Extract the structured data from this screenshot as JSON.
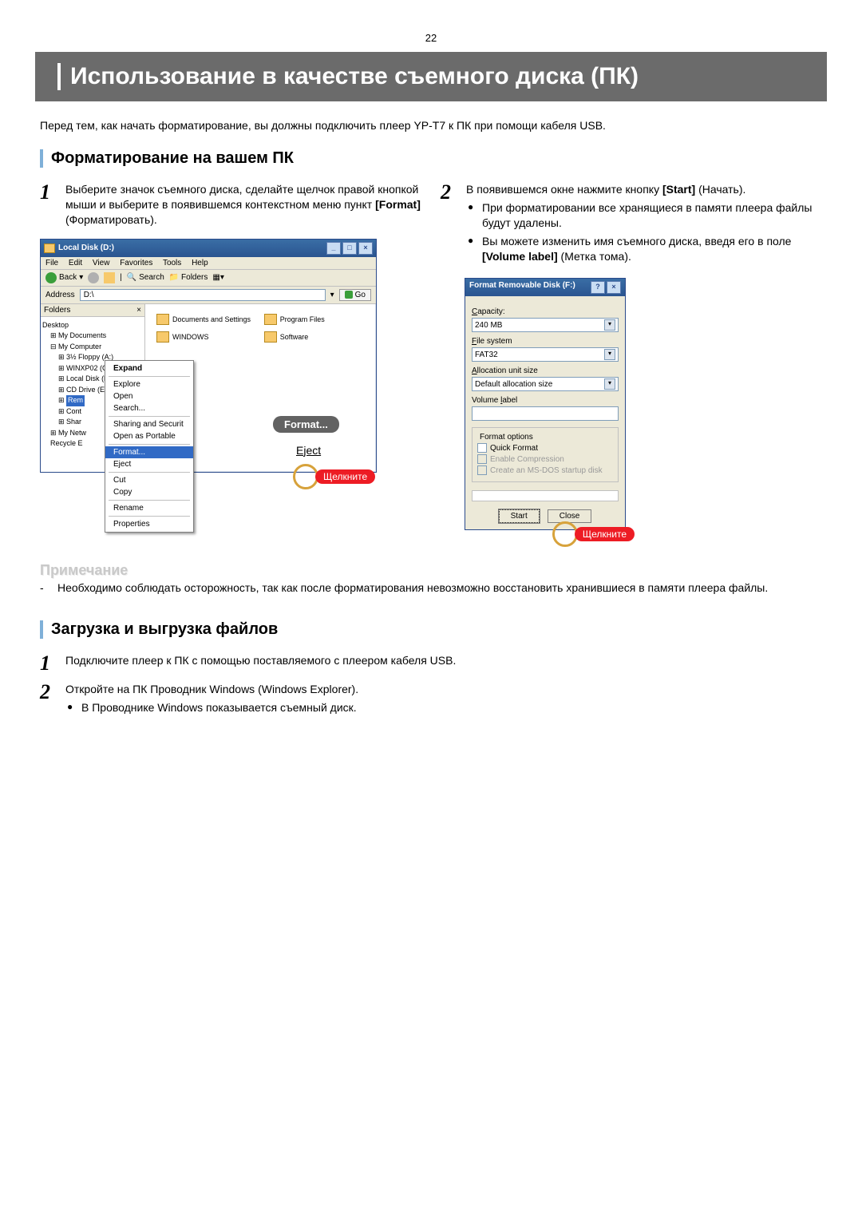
{
  "page_number": "22",
  "title": "Использование в качестве съемного диска (ПК)",
  "intro": "Перед тем, как начать форматирование, вы должны подключить плеер YP-T7 к ПК при помощи кабеля USB.",
  "section1_heading": "Форматирование на вашем ПК",
  "step1_num": "1",
  "step1_text_a": "Выберите значок съемного диска, сделайте щелчок правой кнопкой мыши и выберите в появившемся контекстном меню пункт ",
  "step1_bold": "[Format]",
  "step1_text_b": " (Форматировать).",
  "step2_num": "2",
  "step2_text_a": "В появившемся окне нажмите кнопку ",
  "step2_bold": "[Start]",
  "step2_text_b": " (Начать).",
  "step2_bullet1": "При форматировании все хранящиеся в памяти плеера файлы будут удалены.",
  "step2_bullet2_a": "Вы можете изменить имя съемного диска, введя его в поле ",
  "step2_bullet2_bold": "[Volume label]",
  "step2_bullet2_b": " (Метка тома).",
  "explorer": {
    "title": "Local Disk (D:)",
    "menu": [
      "File",
      "Edit",
      "View",
      "Favorites",
      "Tools",
      "Help"
    ],
    "toolbar_back": "Back",
    "toolbar_search": "Search",
    "toolbar_folders": "Folders",
    "address_label": "Address",
    "address_value": "D:\\",
    "go": "Go",
    "folders_header": "Folders",
    "tree": {
      "desktop": "Desktop",
      "mydocs": "My Documents",
      "mycomputer": "My Computer",
      "floppy": "3½ Floppy (A:)",
      "winxp": "WINXP02 (C:)",
      "localdisk": "Local Disk (D:)",
      "cddrive": "CD Drive (E:)",
      "removable": "Rem",
      "control": "Cont",
      "shared": "Shar",
      "mynet": "My Netw",
      "recycle": "Recycle E"
    },
    "context_menu": {
      "expand": "Expand",
      "explore": "Explore",
      "open": "Open",
      "search": "Search...",
      "sharing": "Sharing and Securit",
      "portable": "Open as Portable",
      "format": "Format...",
      "eject": "Eject",
      "cut": "Cut",
      "copy": "Copy",
      "rename": "Rename",
      "properties": "Properties"
    },
    "folders_content": [
      "Documents and Settings",
      "Program Files",
      "WINDOWS",
      "Software"
    ],
    "callout_format": "Format...",
    "callout_eject": "Eject",
    "callout_click": "Щелкните"
  },
  "format_dialog": {
    "title": "Format Removable Disk (F:)",
    "capacity_label": "Capacity:",
    "capacity_value": "240 MB",
    "filesystem_label": "File system",
    "filesystem_value": "FAT32",
    "alloc_label": "Allocation unit size",
    "alloc_value": "Default allocation size",
    "volume_label": "Volume label",
    "options_legend": "Format options",
    "opt_quick": "Quick Format",
    "opt_compress": "Enable Compression",
    "opt_msdos": "Create an MS-DOS startup disk",
    "btn_start": "Start",
    "btn_close": "Close",
    "callout_click": "Щелкните"
  },
  "note_heading": "Примечание",
  "note_text": "Необходимо соблюдать осторожность, так как после форматирования невозможно восстановить хранившиеся в памяти плеера файлы.",
  "section2_heading": "Загрузка и выгрузка файлов",
  "s2_step1_num": "1",
  "s2_step1_text": "Подключите плеер к ПК с помощью поставляемого с плеером кабеля USB.",
  "s2_step2_num": "2",
  "s2_step2_text": "Откройте на ПК Проводник Windows (Windows Explorer).",
  "s2_step2_bullet": "В Проводнике Windows показывается съемный диск."
}
